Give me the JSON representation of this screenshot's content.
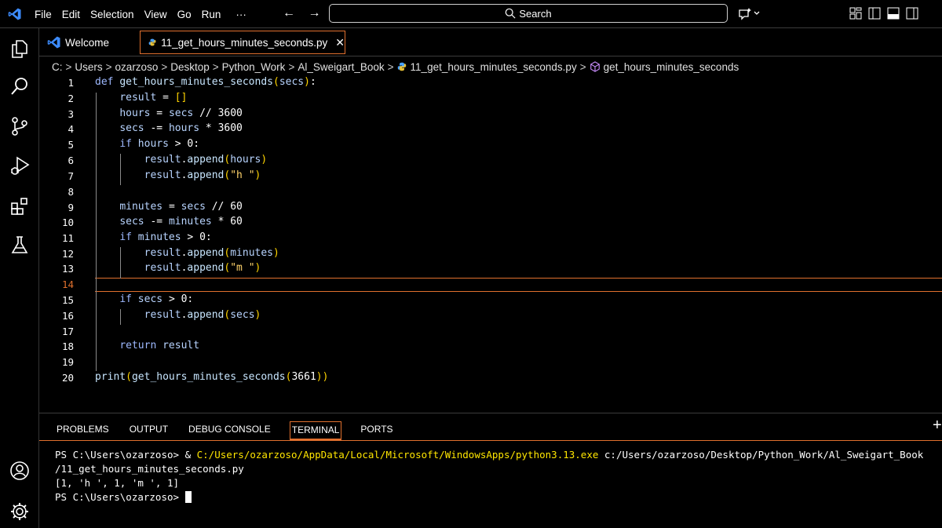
{
  "menu": [
    "File",
    "Edit",
    "Selection",
    "View",
    "Go",
    "Run",
    "···"
  ],
  "nav_arrows": "← →",
  "search": {
    "label": "Search"
  },
  "tabs": [
    {
      "label": "Welcome",
      "icon": "vscode-logo-icon"
    },
    {
      "label": "11_get_hours_minutes_seconds.py",
      "icon": "python-icon",
      "active": true,
      "close": "✕"
    }
  ],
  "breadcrumb": [
    "C:",
    "Users",
    "ozarzoso",
    "Desktop",
    "Python_Work",
    "Al_Sweigart_Book",
    "11_get_hours_minutes_seconds.py",
    "get_hours_minutes_seconds"
  ],
  "breadcrumb_sep": ">",
  "editor": {
    "current_line": 14,
    "line_numbers": [
      "1",
      "2",
      "3",
      "4",
      "5",
      "6",
      "7",
      "8",
      "9",
      "10",
      "11",
      "12",
      "13",
      "14",
      "15",
      "16",
      "17",
      "18",
      "19",
      "20"
    ],
    "lines": [
      "def get_hours_minutes_seconds(secs):",
      "    result = []",
      "    hours = secs // 3600",
      "    secs -= hours * 3600",
      "    if hours > 0:",
      "        result.append(hours)",
      "        result.append(\"h \")",
      "",
      "    minutes = secs // 60",
      "    secs -= minutes * 60",
      "    if minutes > 0:",
      "        result.append(minutes)",
      "        result.append(\"m \")",
      "",
      "    if secs > 0:",
      "        result.append(secs)",
      "",
      "    return result",
      "",
      "print(get_hours_minutes_seconds(3661))"
    ]
  },
  "panel": {
    "tabs": [
      "PROBLEMS",
      "OUTPUT",
      "DEBUG CONSOLE",
      "TERMINAL",
      "PORTS"
    ],
    "active_tab": "TERMINAL",
    "add": "+"
  },
  "terminal": {
    "prompt1": "PS C:\\Users\\ozarzoso> & ",
    "cmd": "C:/Users/ozarzoso/AppData/Local/Microsoft/WindowsApps/python3.13.exe",
    "arg1": " c:/Users/ozarzoso/Desktop/Python_Work/Al_Sweigart_Book",
    "arg2": "/11_get_hours_minutes_seconds.py",
    "output": "[1, 'h ', 1, 'm ', 1]",
    "prompt2": "PS C:\\Users\\ozarzoso> "
  },
  "colors": {
    "accent": "#e0702e",
    "keyword": "#9eb9ff",
    "string": "#ffd36b",
    "terminal_cmd": "#ffe600"
  }
}
